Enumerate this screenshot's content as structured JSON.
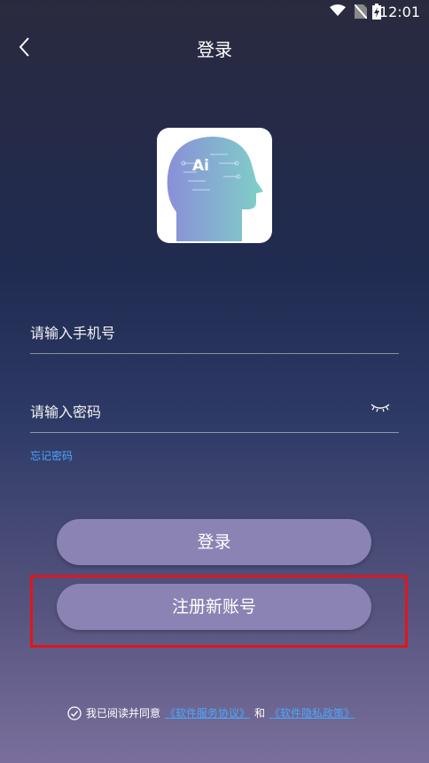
{
  "status_bar": {
    "time": "12:01"
  },
  "header": {
    "title": "登录",
    "back_icon": "chevron-left-icon"
  },
  "logo": {
    "text": "Ai"
  },
  "form": {
    "phone_placeholder": "请输入手机号",
    "password_placeholder": "请输入密码",
    "forgot_password": "忘记密码"
  },
  "buttons": {
    "login": "登录",
    "register": "注册新账号"
  },
  "agreement": {
    "prefix": "我已阅读并同意",
    "link1": "《软件服务协议》",
    "conjunction": "和",
    "link2": "《软件隐私政策》"
  },
  "colors": {
    "accent_link": "#4aa8ff",
    "button": "#8a83b3",
    "highlight_border": "#e3141b"
  }
}
